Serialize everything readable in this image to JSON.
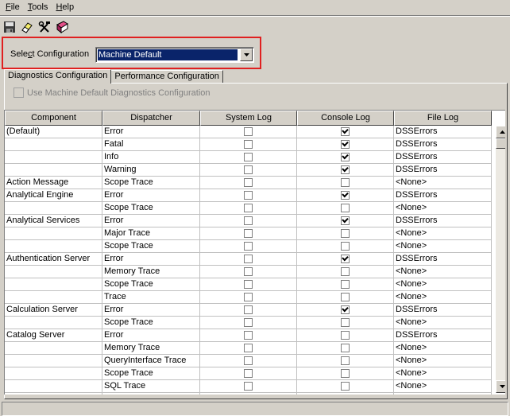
{
  "menu": {
    "items": [
      {
        "label": "File",
        "accel": "F",
        "rest": "ile"
      },
      {
        "label": "Tools",
        "accel": "T",
        "rest": "ools"
      },
      {
        "label": "Help",
        "accel": "H",
        "rest": "elp"
      }
    ]
  },
  "toolbar": {
    "icons": [
      "save-icon",
      "eraser-icon",
      "tools-icon",
      "book-icon"
    ]
  },
  "config": {
    "label_pre": "Sele",
    "label_accel": "c",
    "label_post": "t Configuration",
    "selected": "Machine Default"
  },
  "tabs": [
    {
      "label": "Diagnostics Configuration",
      "active": true
    },
    {
      "label": "Performance Configuration",
      "active": false
    }
  ],
  "use_default_label": "Use Machine Default Diagnostics Configuration",
  "grid": {
    "columns": [
      "Component",
      "Dispatcher",
      "System Log",
      "Console Log",
      "File Log"
    ],
    "rows": [
      {
        "component": "(Default)",
        "dispatcher": "Error",
        "system": false,
        "console": true,
        "file": "DSSErrors"
      },
      {
        "component": "",
        "dispatcher": "Fatal",
        "system": false,
        "console": true,
        "file": "DSSErrors"
      },
      {
        "component": "",
        "dispatcher": "Info",
        "system": false,
        "console": true,
        "file": "DSSErrors"
      },
      {
        "component": "",
        "dispatcher": "Warning",
        "system": false,
        "console": true,
        "file": "DSSErrors"
      },
      {
        "component": "Action Message",
        "dispatcher": "Scope Trace",
        "system": false,
        "console": false,
        "file": "<None>"
      },
      {
        "component": "Analytical Engine",
        "dispatcher": "Error",
        "system": false,
        "console": true,
        "file": "DSSErrors"
      },
      {
        "component": "",
        "dispatcher": "Scope Trace",
        "system": false,
        "console": false,
        "file": "<None>"
      },
      {
        "component": "Analytical Services",
        "dispatcher": "Error",
        "system": false,
        "console": true,
        "file": "DSSErrors"
      },
      {
        "component": "",
        "dispatcher": "Major Trace",
        "system": false,
        "console": false,
        "file": "<None>"
      },
      {
        "component": "",
        "dispatcher": "Scope Trace",
        "system": false,
        "console": false,
        "file": "<None>"
      },
      {
        "component": "Authentication Server",
        "dispatcher": "Error",
        "system": false,
        "console": true,
        "file": "DSSErrors"
      },
      {
        "component": "",
        "dispatcher": "Memory Trace",
        "system": false,
        "console": false,
        "file": "<None>"
      },
      {
        "component": "",
        "dispatcher": "Scope Trace",
        "system": false,
        "console": false,
        "file": "<None>"
      },
      {
        "component": "",
        "dispatcher": "Trace",
        "system": false,
        "console": false,
        "file": "<None>"
      },
      {
        "component": "Calculation Server",
        "dispatcher": "Error",
        "system": false,
        "console": true,
        "file": "DSSErrors"
      },
      {
        "component": "",
        "dispatcher": "Scope Trace",
        "system": false,
        "console": false,
        "file": "<None>"
      },
      {
        "component": "Catalog Server",
        "dispatcher": "Error",
        "system": false,
        "console": false,
        "file": "DSSErrors"
      },
      {
        "component": "",
        "dispatcher": "Memory Trace",
        "system": false,
        "console": false,
        "file": "<None>"
      },
      {
        "component": "",
        "dispatcher": "QueryInterface Trace",
        "system": false,
        "console": false,
        "file": "<None>"
      },
      {
        "component": "",
        "dispatcher": "Scope Trace",
        "system": false,
        "console": false,
        "file": "<None>"
      },
      {
        "component": "",
        "dispatcher": "SQL Trace",
        "system": false,
        "console": false,
        "file": "<None>"
      },
      {
        "component": "",
        "dispatcher": "",
        "system": false,
        "console": false,
        "file": ""
      }
    ]
  },
  "colors": {
    "highlight_border": "#e02020",
    "selection": "#0a246a",
    "face": "#d4d0c8"
  }
}
